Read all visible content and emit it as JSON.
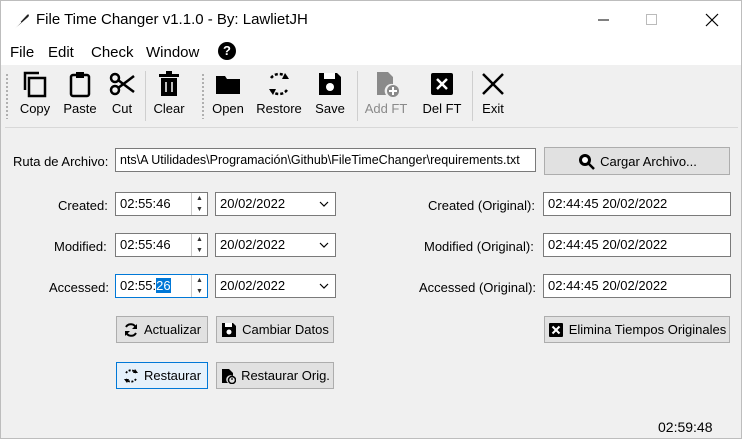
{
  "window": {
    "title": "File Time Changer v1.1.0 - By: LawlietJH"
  },
  "menu": [
    "File",
    "Edit",
    "Check",
    "Window"
  ],
  "toolbar": {
    "copy": "Copy",
    "paste": "Paste",
    "cut": "Cut",
    "clear": "Clear",
    "open": "Open",
    "restore": "Restore",
    "save": "Save",
    "add_ft": "Add FT",
    "del_ft": "Del FT",
    "exit": "Exit"
  },
  "file": {
    "label": "Ruta de Archivo:",
    "path": "nts\\A Utilidades\\Programación\\Github\\FileTimeChanger\\requirements.txt",
    "load_button": "Cargar Archivo..."
  },
  "times": {
    "created_label": "Created:",
    "created_time": "02:55:46",
    "created_date": "20/02/2022",
    "modified_label": "Modified:",
    "modified_time": "02:55:46",
    "modified_date": "20/02/2022",
    "accessed_label": "Accessed:",
    "accessed_time_prefix": "02:55:",
    "accessed_time_selected": "26",
    "accessed_date": "20/02/2022"
  },
  "original": {
    "created_label": "Created (Original):",
    "created_value": "02:44:45 20/02/2022",
    "modified_label": "Modified (Original):",
    "modified_value": "02:44:45 20/02/2022",
    "accessed_label": "Accessed (Original):",
    "accessed_value": "02:44:45 20/02/2022"
  },
  "buttons": {
    "actualizar": "Actualizar",
    "cambiar": "Cambiar Datos",
    "elimina": "Elimina Tiempos Originales",
    "restaurar": "Restaurar",
    "restaurar_orig": "Restaurar Orig."
  },
  "status": {
    "clock": "02:59:48"
  }
}
